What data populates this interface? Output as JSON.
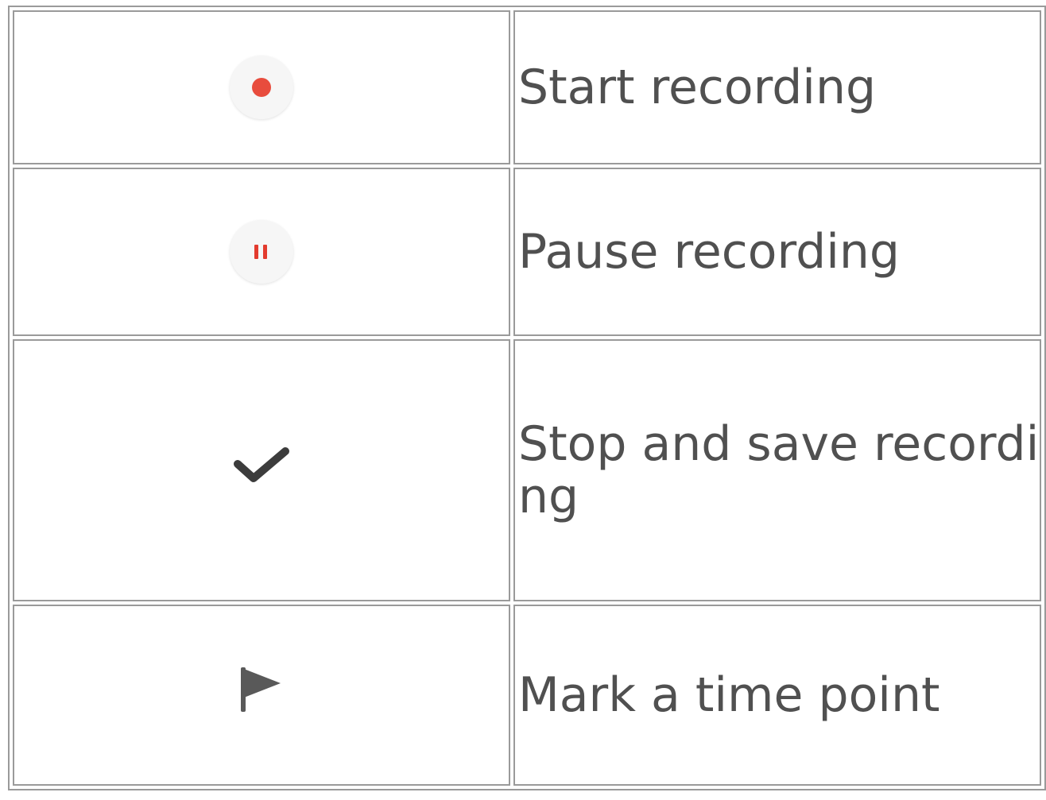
{
  "rows": [
    {
      "icon": "record-icon",
      "label": "Start recording",
      "accent": "#e84c3d"
    },
    {
      "icon": "pause-icon",
      "label": "Pause recording",
      "accent": "#e33b2e"
    },
    {
      "icon": "checkmark-icon",
      "label": "Stop and save recording",
      "accent": "#3c3c3c"
    },
    {
      "icon": "flag-icon",
      "label": "Mark a time point",
      "accent": "#595959"
    }
  ]
}
